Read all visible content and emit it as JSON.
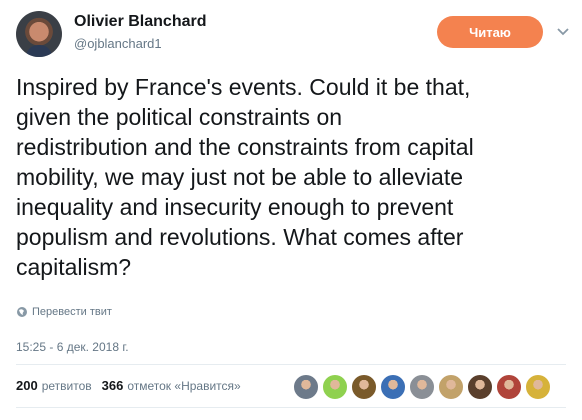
{
  "author": {
    "name": "Olivier Blanchard",
    "handle": "@ojblanchard1"
  },
  "follow_button": {
    "label": "Читаю",
    "color": "#f4824f"
  },
  "tweet": {
    "lines": [
      "Inspired by France's events. Could it be that,",
      "given the political constraints on",
      "redistribution and the constraints from capital",
      "mobility, we may just not be able to alleviate",
      "inequality and insecurity enough to prevent",
      "populism and revolutions. What comes after",
      "capitalism?"
    ]
  },
  "translate_label": "Перевести твит",
  "timestamp": "15:25 - 6 дек. 2018 г.",
  "stats": {
    "retweets_count": "200",
    "retweets_label": "ретвитов",
    "likes_count": "366",
    "likes_label": "отметок «Нравится»"
  },
  "liker_avatars": [
    "#6d7a8a",
    "#8fd14f",
    "#7a5a2a",
    "#3b6fb5",
    "#8a8f96",
    "#c2a26a",
    "#5a3f2c",
    "#b0443a",
    "#d6b23a"
  ],
  "icons": {
    "menu": "chevron-down-icon",
    "translate": "globe-icon"
  }
}
